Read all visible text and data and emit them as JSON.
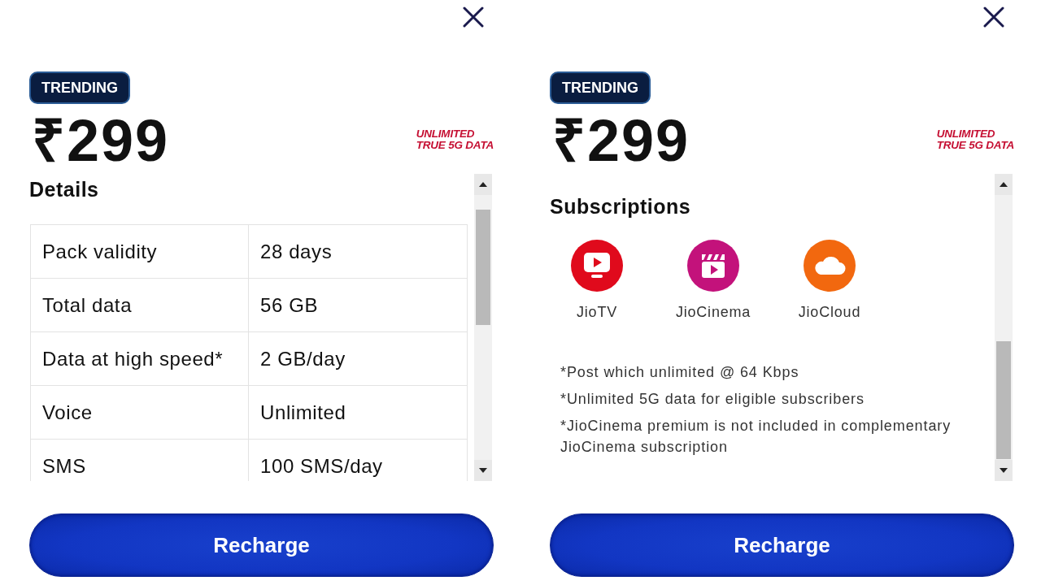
{
  "panels": [
    {
      "badge": "TRENDING",
      "price": "₹299",
      "tag": [
        "UNLIMITED",
        "TRUE 5G DATA"
      ],
      "section": {
        "kind": "details",
        "heading": "Details",
        "rows": [
          {
            "label": "Pack validity",
            "value": "28 days"
          },
          {
            "label": "Total data",
            "value": "56 GB"
          },
          {
            "label": "Data at high speed*",
            "value": "2 GB/day"
          },
          {
            "label": "Voice",
            "value": "Unlimited"
          },
          {
            "label": "SMS",
            "value": "100 SMS/day"
          }
        ]
      },
      "button": "Recharge"
    },
    {
      "badge": "TRENDING",
      "price": "₹299",
      "tag": [
        "UNLIMITED",
        "TRUE 5G DATA"
      ],
      "section": {
        "kind": "subscriptions",
        "heading": "Subscriptions",
        "apps": [
          {
            "name": "JioTV",
            "color": "#e00a1c"
          },
          {
            "name": "JioCinema",
            "color": "#c3127b"
          },
          {
            "name": "JioCloud",
            "color": "#f2680f"
          }
        ],
        "notes": [
          "*Post which unlimited @ 64 Kbps",
          "*Unlimited 5G data for eligible subscribers",
          "*JioCinema premium is not included in complementary JioCinema subscription"
        ]
      },
      "button": "Recharge"
    }
  ]
}
